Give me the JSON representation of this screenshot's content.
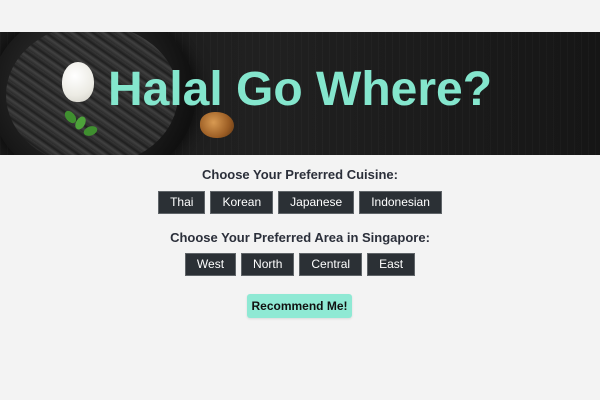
{
  "header": {
    "title": "Halal Go Where?"
  },
  "cuisine": {
    "label": "Choose Your Preferred Cuisine:",
    "options": [
      "Thai",
      "Korean",
      "Japanese",
      "Indonesian"
    ]
  },
  "area": {
    "label": "Choose Your Preferred Area in Singapore:",
    "options": [
      "West",
      "North",
      "Central",
      "East"
    ]
  },
  "actions": {
    "recommend_label": "Recommend Me!"
  },
  "colors": {
    "page_background": "#f3f3f3",
    "title": "#84e6cd",
    "option_button": "#2b3035",
    "recommend_button": "#8fe9d4"
  }
}
